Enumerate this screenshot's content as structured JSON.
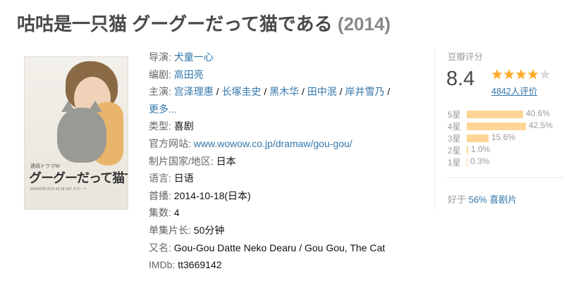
{
  "title": {
    "name": "咕咕是一只猫 グーグーだって猫である",
    "year": "(2014)"
  },
  "poster": {
    "title_text": "グーグーだって猫である",
    "channel": "連続ドラマW",
    "credits": "WOWOW 2014.10.18 SAT スタート"
  },
  "info": {
    "director_label": "导演:",
    "director": [
      "犬童一心"
    ],
    "writer_label": "编剧:",
    "writer": [
      "高田亮"
    ],
    "cast_label": "主演:",
    "cast": [
      "宫泽理惠",
      "长塚圭史",
      "黑木华",
      "田中泯",
      "岸井雪乃"
    ],
    "cast_sep": " / ",
    "more": "更多...",
    "genre_label": "类型:",
    "genre": "喜剧",
    "website_label": "官方网站:",
    "website": "www.wowow.co.jp/dramaw/gou-gou/",
    "country_label": "制片国家/地区:",
    "country": "日本",
    "language_label": "语言:",
    "language": "日语",
    "premiere_label": "首播:",
    "premiere": "2014-10-18(日本)",
    "episodes_label": "集数:",
    "episodes": "4",
    "runtime_label": "单集片长:",
    "runtime": "50分钟",
    "aka_label": "又名:",
    "aka": "Gou-Gou Datte Neko Dearu / Gou Gou, The Cat",
    "imdb_label": "IMDb:",
    "imdb": "tt3669142"
  },
  "rating": {
    "label": "豆瓣评分",
    "score": "8.4",
    "stars": 4,
    "votes": "4842人评价",
    "bars": [
      {
        "label": "5星",
        "percent": 40.6,
        "text": "40.6%"
      },
      {
        "label": "4星",
        "percent": 42.5,
        "text": "42.5%"
      },
      {
        "label": "3星",
        "percent": 15.6,
        "text": "15.6%"
      },
      {
        "label": "2星",
        "percent": 1.0,
        "text": "1.0%"
      },
      {
        "label": "1星",
        "percent": 0.3,
        "text": "0.3%"
      }
    ],
    "better_prefix": "好于",
    "better_link": "56% 喜剧片"
  },
  "colors": {
    "link": "#3377aa",
    "star": "#ffac2d",
    "bar": "#ffd596",
    "title": "#494949"
  }
}
